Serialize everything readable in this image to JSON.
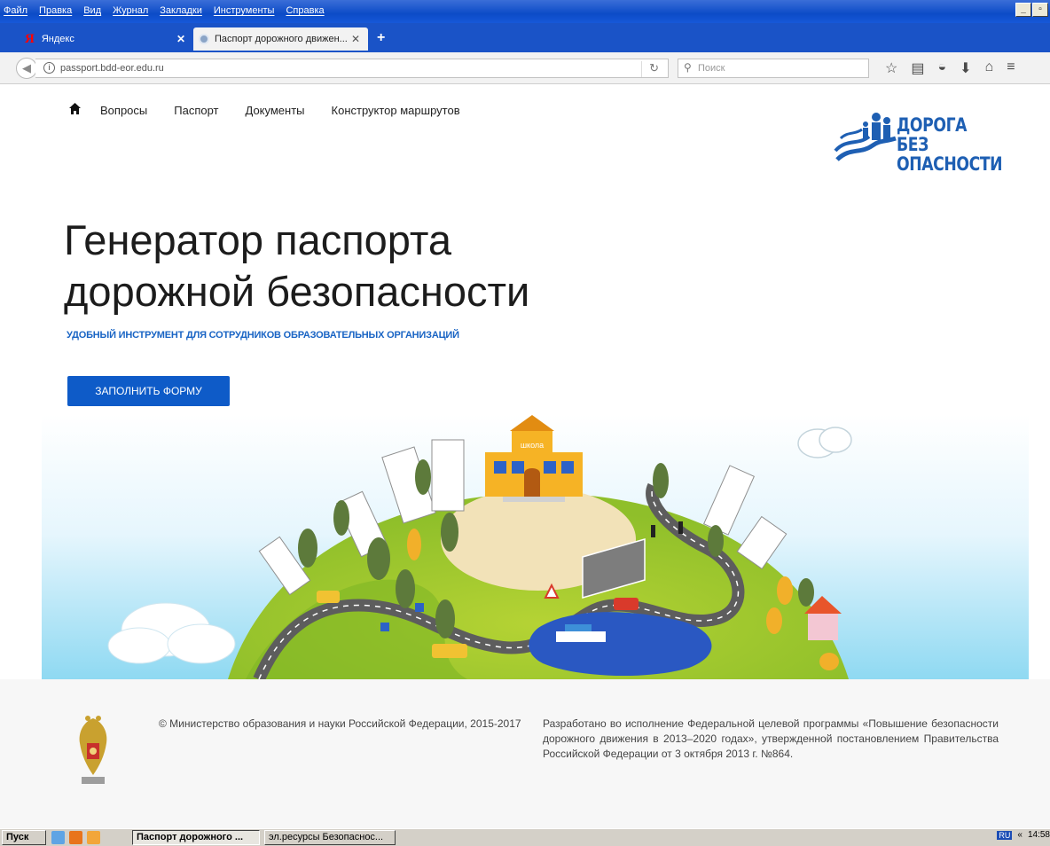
{
  "menubar": {
    "items": [
      "Файл",
      "Правка",
      "Вид",
      "Журнал",
      "Закладки",
      "Инструменты",
      "Справка"
    ],
    "window_buttons": [
      "_",
      "▫"
    ]
  },
  "tabs": [
    {
      "label": "Яндекс"
    },
    {
      "label": "Паспорт дорожного движен..."
    }
  ],
  "navbar": {
    "url": "passport.bdd-eor.edu.ru",
    "search_placeholder": "Поиск"
  },
  "site_nav": {
    "links": [
      "Вопросы",
      "Паспорт",
      "Документы",
      "Конструктор маршрутов"
    ]
  },
  "logo": {
    "line1": "ДОРОГА БЕЗ",
    "line2": "ОПАСНОСТИ"
  },
  "hero": {
    "title_line1": "Генератор паспорта",
    "title_line2": "дорожной безопасности",
    "subtitle": "УДОБНЫЙ ИНСТРУМЕНТ ДЛЯ СОТРУДНИКОВ ОБРАЗОВАТЕЛЬНЫХ ОРГАНИЗАЦИЙ",
    "cta_label": "ЗАПОЛНИТЬ ФОРМУ",
    "school_sign": "школа"
  },
  "footer": {
    "copyright": "© Министерство образования и науки Российской Федерации, 2015-2017",
    "developed": "Разработано во исполнение Федеральной целевой программы «Повышение безопасности дорожного движения в 2013–2020 годах», утвержденной постановлением Правительства Российской Федерации от 3 октября 2013 г. №864."
  },
  "taskbar": {
    "start": "Пуск",
    "tasks": [
      "Паспорт дорожного ...",
      "эл.ресурсы Безопаснос..."
    ],
    "lang": "RU",
    "clock": "14:58"
  },
  "colors": {
    "accent": "#0e5bc8",
    "subtitle": "#1964c4",
    "brand": "#1e5fb3"
  }
}
